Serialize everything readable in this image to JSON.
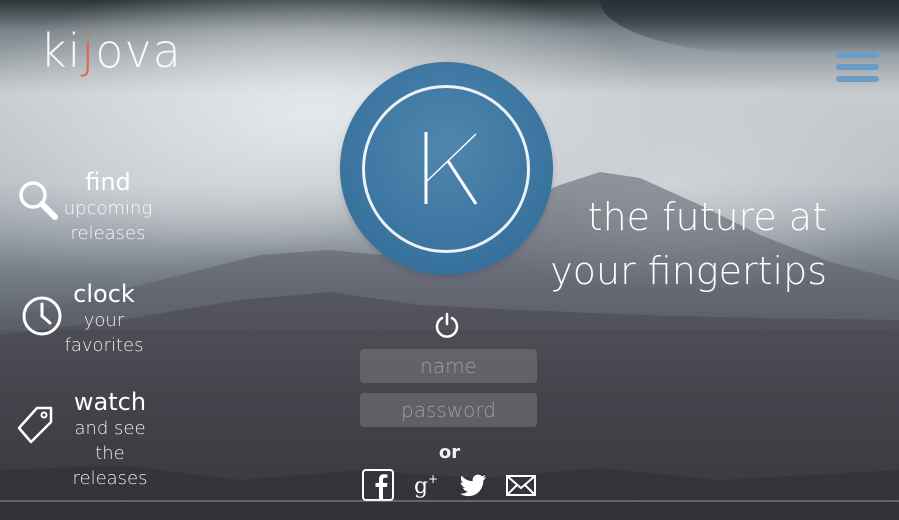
{
  "brand": {
    "logo_prefix": "ki",
    "logo_accent": "j",
    "logo_suffix": "ova",
    "accent_color": "#e0664e",
    "badge_color": "#2d6a97",
    "menu_color": "#6a9cc4"
  },
  "tagline": {
    "line1": "the future at",
    "line2": "your fingertips"
  },
  "features": [
    {
      "title": "find",
      "line1": "upcoming",
      "line2": "releases",
      "icon": "search-icon"
    },
    {
      "title": "clock",
      "line1": "your",
      "line2": "favorites",
      "icon": "clock-icon"
    },
    {
      "title": "watch",
      "line1": "and see",
      "line2": "the releases",
      "icon": "tag-icon"
    }
  ],
  "login": {
    "name_placeholder": "name",
    "password_placeholder": "password",
    "or_label": "or",
    "power_icon": "power-icon"
  },
  "social": [
    "facebook-icon",
    "google-plus-icon",
    "twitter-icon",
    "email-icon"
  ]
}
